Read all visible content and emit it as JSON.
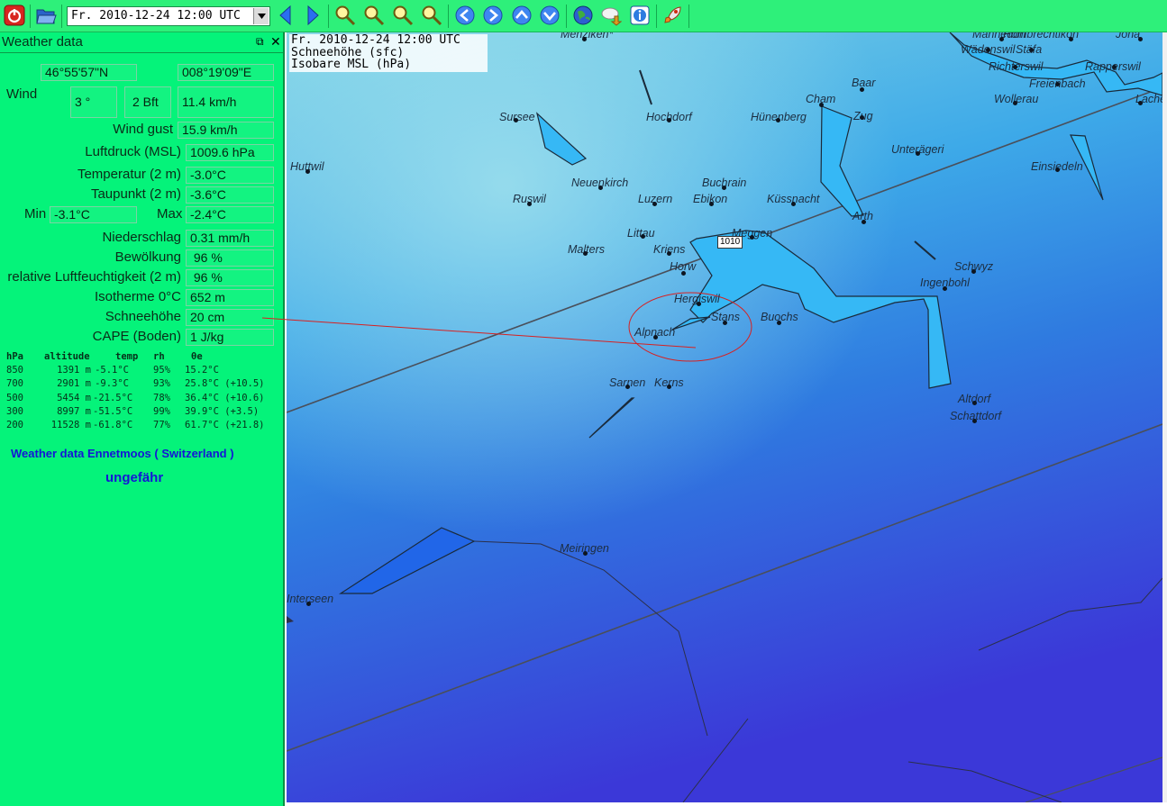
{
  "toolbar": {
    "date": "Fr. 2010-12-24 12:00 UTC",
    "buttons": [
      "power-icon",
      "open-folder-icon",
      "prev-arrow-icon",
      "next-arrow-icon",
      "zoom-in-icon",
      "zoom-out-icon",
      "zoom-selection-icon",
      "zoom-all-icon",
      "nav-left-icon",
      "nav-right-icon",
      "nav-up-icon",
      "nav-down-icon",
      "globe-icon",
      "download-icon",
      "info-icon",
      "rocket-icon"
    ]
  },
  "panel": {
    "title": "Weather data",
    "lat": "46°55'57\"N",
    "lon": "008°19'09\"E",
    "wind_label": "Wind",
    "wind_dir": "3 °",
    "wind_bft": "2 Bft",
    "wind_speed": "11.4  km/h",
    "gust_label": "Wind gust",
    "gust_value": "15.9  km/h",
    "pressure_label": "Luftdruck (MSL)",
    "pressure_value": "1009.6 hPa",
    "temp_label": "Temperatur (2 m)",
    "temp_value": "-3.0°C",
    "dew_label": "Taupunkt (2 m)",
    "dew_value": "-3.6°C",
    "min_label": "Min",
    "min_value": "-3.1°C",
    "max_label": "Max",
    "max_value": "-2.4°C",
    "precip_label": "Niederschlag",
    "precip_value": "0.31 mm/h",
    "cloud_label": "Bewölkung",
    "cloud_value": " 96 %",
    "rh_label": "relative Luftfeuchtigkeit (2 m)",
    "rh_value": " 96 %",
    "iso_label": "Isotherme 0°C",
    "iso_value": "652 m",
    "snow_label": "Schneehöhe",
    "snow_value": "20 cm",
    "cape_label": "CAPE (Boden)",
    "cape_value": "1 J/kg",
    "sounding_header": [
      "hPa",
      "altitude",
      "temp",
      "rh",
      "θe"
    ],
    "sounding_rows": [
      [
        "850",
        "1391 m",
        "-5.1°C",
        "95%",
        "15.2°C"
      ],
      [
        "700",
        "2901 m",
        "-9.3°C",
        "93%",
        "25.8°C (+10.5)"
      ],
      [
        "500",
        "5454 m",
        "-21.5°C",
        "78%",
        "36.4°C (+10.6)"
      ],
      [
        "300",
        "8997 m",
        "-51.5°C",
        "99%",
        "39.9°C (+3.5)"
      ],
      [
        "200",
        "11528 m",
        "-61.8°C",
        "77%",
        "61.7°C (+21.8)"
      ]
    ],
    "location_title": "Weather data Ennetmoos ( Switzerland )",
    "location_sub": "ungefähr"
  },
  "map": {
    "info_date": "Fr. 2010-12-24 12:00 UTC",
    "info_layer1": "Schneehöhe (sfc)",
    "info_layer2": "Isobare MSL (hPa)",
    "isobar_label": "1010",
    "cities": [
      {
        "name": "Menziken*"
      },
      {
        "name": "Mannedorf"
      },
      {
        "name": "Hombrechtikon"
      },
      {
        "name": "Jona"
      },
      {
        "name": "Wädenswil"
      },
      {
        "name": "Stäfa"
      },
      {
        "name": "Richterswil"
      },
      {
        "name": "Rapperswil"
      },
      {
        "name": "Freienbach"
      },
      {
        "name": "Baar"
      },
      {
        "name": "Cham"
      },
      {
        "name": "Zug"
      },
      {
        "name": "Wollerau"
      },
      {
        "name": "Lachen"
      },
      {
        "name": "Sursee"
      },
      {
        "name": "Hochdorf"
      },
      {
        "name": "Hünenberg"
      },
      {
        "name": "Unterägeri"
      },
      {
        "name": "Huttwil"
      },
      {
        "name": "Einsiedeln"
      },
      {
        "name": "Neuenkirch"
      },
      {
        "name": "Buchrain"
      },
      {
        "name": "Ruswil"
      },
      {
        "name": "Luzern"
      },
      {
        "name": "Ebikon"
      },
      {
        "name": "Küssnacht"
      },
      {
        "name": "Arth"
      },
      {
        "name": "Littau"
      },
      {
        "name": "Meggen"
      },
      {
        "name": "Malters"
      },
      {
        "name": "Kriens"
      },
      {
        "name": "Horw"
      },
      {
        "name": "Schwyz"
      },
      {
        "name": "Ingenbohl"
      },
      {
        "name": "Hergiswil"
      },
      {
        "name": "Stans"
      },
      {
        "name": "Buochs"
      },
      {
        "name": "Alpnach"
      },
      {
        "name": "Sarnen"
      },
      {
        "name": "Kerns"
      },
      {
        "name": "Altdorf"
      },
      {
        "name": "Schattdorf"
      },
      {
        "name": "Meiringen"
      },
      {
        "name": "Interseen"
      }
    ]
  }
}
